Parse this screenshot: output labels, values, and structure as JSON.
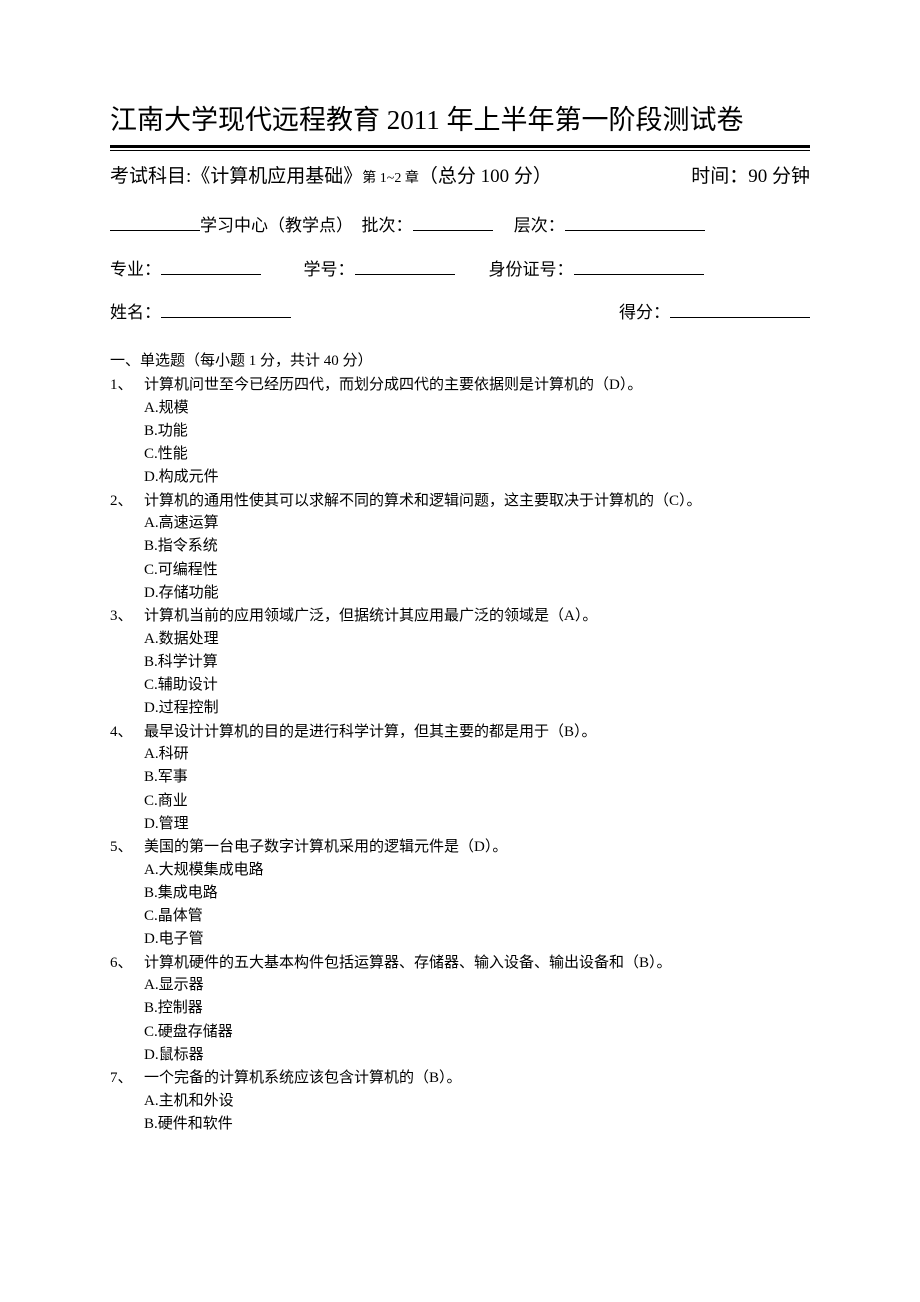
{
  "title": "江南大学现代远程教育 2011 年上半年第一阶段测试卷",
  "subject_prefix": "考试科目:",
  "subject_name": "《计算机应用基础》",
  "subject_chapter": "第 1~2 章",
  "subject_score": "（总分 100 分）",
  "time_label": "时间：90 分钟",
  "info": {
    "center": "学习中心（教学点）",
    "batch": "批次：",
    "level": "层次：",
    "major": "专业：",
    "student_id": "学号：",
    "id_card": "身份证号：",
    "name": "姓名：",
    "score": "得分："
  },
  "section1_title": "一、单选题（每小题 1 分，共计 40 分）",
  "questions": [
    {
      "num": "1、",
      "stem": "计算机问世至今已经历四代，而划分成四代的主要依据则是计算机的（D）。",
      "options": [
        "A.规模",
        "B.功能",
        "C.性能",
        "D.构成元件"
      ]
    },
    {
      "num": "2、",
      "stem": "计算机的通用性使其可以求解不同的算术和逻辑问题，这主要取决于计算机的（C）。",
      "options": [
        "A.高速运算",
        "B.指令系统",
        "C.可编程性",
        "D.存储功能"
      ]
    },
    {
      "num": "3、",
      "stem": "计算机当前的应用领域广泛，但据统计其应用最广泛的领域是（A）。",
      "options": [
        "A.数据处理",
        "B.科学计算",
        "C.辅助设计",
        "D.过程控制"
      ]
    },
    {
      "num": "4、",
      "stem": "最早设计计算机的目的是进行科学计算，但其主要的都是用于（B）。",
      "options": [
        "A.科研",
        "B.军事",
        "C.商业",
        "D.管理"
      ]
    },
    {
      "num": "5、",
      "stem": "美国的第一台电子数字计算机采用的逻辑元件是（D）。",
      "options": [
        "A.大规模集成电路",
        "B.集成电路",
        "C.晶体管",
        "D.电子管"
      ]
    },
    {
      "num": "6、",
      "stem": "计算机硬件的五大基本构件包括运算器、存储器、输入设备、输出设备和（B）。",
      "options": [
        "A.显示器",
        "B.控制器",
        "C.硬盘存储器",
        "D.鼠标器"
      ]
    },
    {
      "num": "7、",
      "stem": "一个完备的计算机系统应该包含计算机的（B）。",
      "options": [
        "A.主机和外设",
        "B.硬件和软件"
      ]
    }
  ]
}
